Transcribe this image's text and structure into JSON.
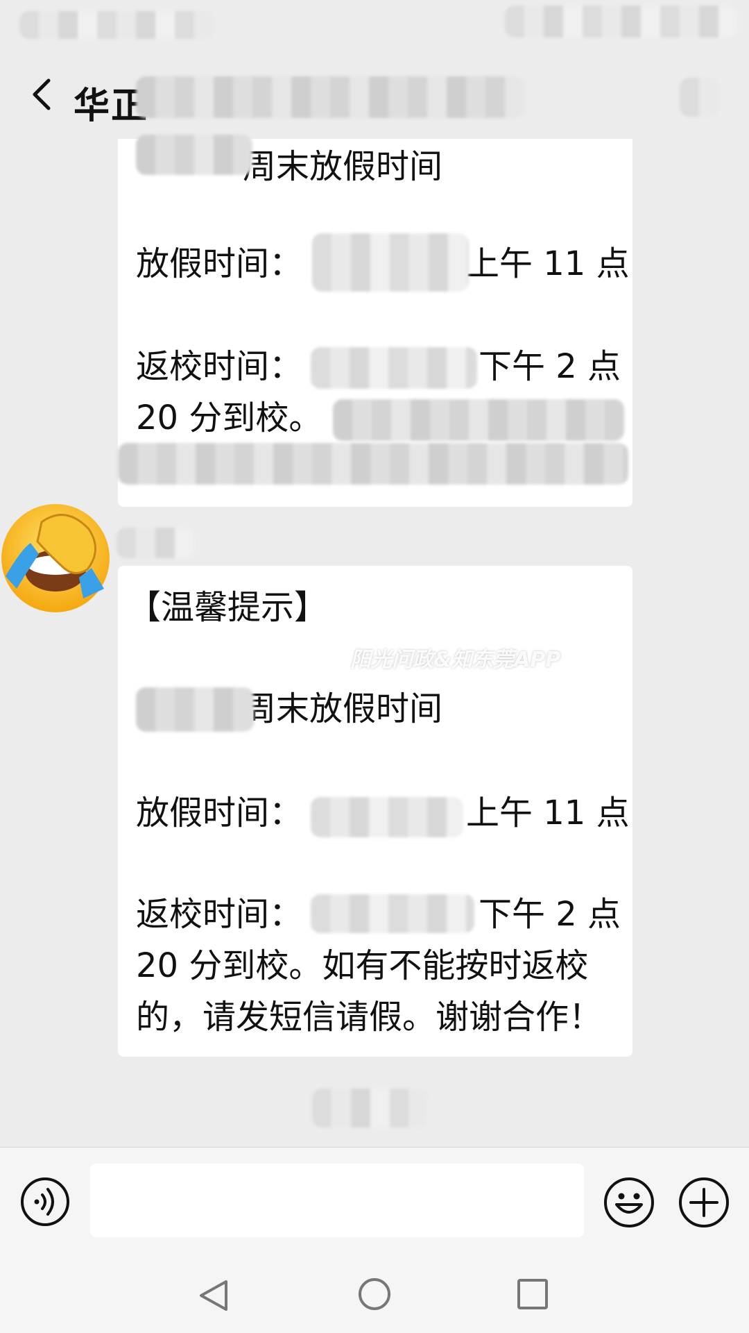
{
  "header": {
    "title_visible": "华正"
  },
  "message1": {
    "lines": [
      "周末放假时间",
      "放假时间：",
      "上午 11 点",
      "返校时间：",
      "下午 2 点",
      "20 分到校。"
    ]
  },
  "message2": {
    "lines": [
      "【温馨提示】",
      "周末放假时间",
      "放假时间：",
      "上午 11 点",
      "返校时间：",
      "下午 2 点",
      "20 分到校。如有不能按时返校",
      "的，请发短信请假。谢谢合作！"
    ]
  },
  "watermark": "阳光问政&知东莞APP",
  "icons": {
    "back": "back-arrow-icon",
    "voice": "voice-icon",
    "emoji": "emoji-icon",
    "plus": "plus-icon",
    "avatar": "facepalm-emoji-icon"
  },
  "colors": {
    "background": "#ececec",
    "bubble": "#ffffff",
    "bar": "#f5f5f5"
  }
}
